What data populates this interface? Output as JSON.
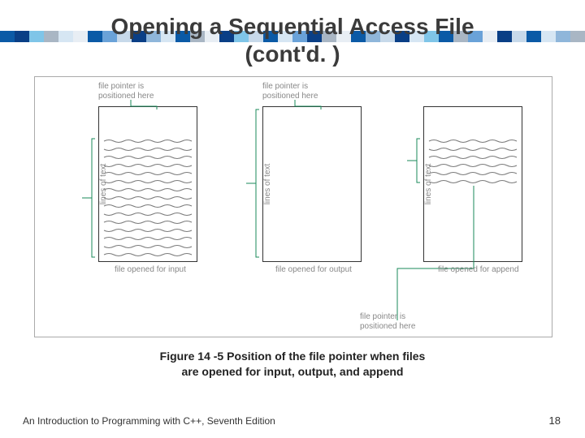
{
  "title_line1": "Opening a Sequential Access File",
  "title_line2": "(cont'd. )",
  "panels": {
    "p1": {
      "pointer_label": "file pointer is\npositioned here",
      "side_label": "lines of text",
      "bottom_label": "file opened for input"
    },
    "p2": {
      "pointer_label": "file pointer is\npositioned here",
      "side_label": "lines of text",
      "bottom_label": "file opened for output"
    },
    "p3": {
      "pointer_label": "file pointer is\npositioned here",
      "side_label": "lines of text",
      "bottom_label": "file opened for append"
    }
  },
  "figure_caption": "Figure 14 -5 Position of the file pointer when files\nare opened for input, output, and append",
  "footer_left": "An Introduction to Programming with C++, Seventh Edition",
  "footer_right": "18",
  "banner_colors": [
    "#0b5aa6",
    "#0a3f86",
    "#7fc5e8",
    "#a9b6c4",
    "#d6e6f3",
    "#e8eef4",
    "#0b5aa6",
    "#6aa2d8",
    "#c7d9ea",
    "#0a3f86",
    "#8fb6da",
    "#d6e6f3",
    "#0b5aa6",
    "#a9b6c4",
    "#e8eef4",
    "#0a3f86",
    "#7fc5e8",
    "#c7d9ea",
    "#0b5aa6",
    "#d6e6f3",
    "#6aa2d8",
    "#0a3f86",
    "#a9b6c4",
    "#e8eef4",
    "#0b5aa6",
    "#8fb6da",
    "#c7d9ea",
    "#0a3f86",
    "#d6e6f3",
    "#7fc5e8",
    "#0b5aa6",
    "#a9b6c4",
    "#6aa2d8",
    "#e8eef4",
    "#0a3f86",
    "#c7d9ea",
    "#0b5aa6",
    "#d6e6f3",
    "#8fb6da",
    "#a9b6c4"
  ]
}
